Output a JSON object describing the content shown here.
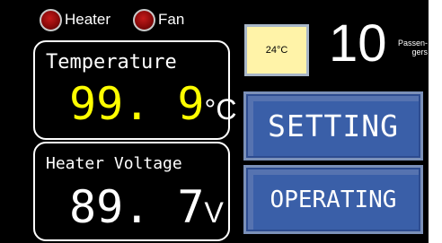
{
  "indicators": [
    {
      "label": "Heater",
      "color": "#c41a1a"
    },
    {
      "label": "Fan",
      "color": "#c41a1a"
    }
  ],
  "temperature": {
    "label": "Temperature",
    "value": "99. 9",
    "unit": "°C",
    "value_color": "#ffff00"
  },
  "heater_voltage": {
    "label": "Heater Voltage",
    "value": "89. 7",
    "unit": "V"
  },
  "setpoint": {
    "value": "24°C",
    "background": "#fff3a8"
  },
  "passengers": {
    "count": "10",
    "label_line1": "Passen-",
    "label_line2": "gers"
  },
  "buttons": {
    "setting": "SETTING",
    "operating": "OPERATING",
    "color": "#3a5fa8"
  }
}
